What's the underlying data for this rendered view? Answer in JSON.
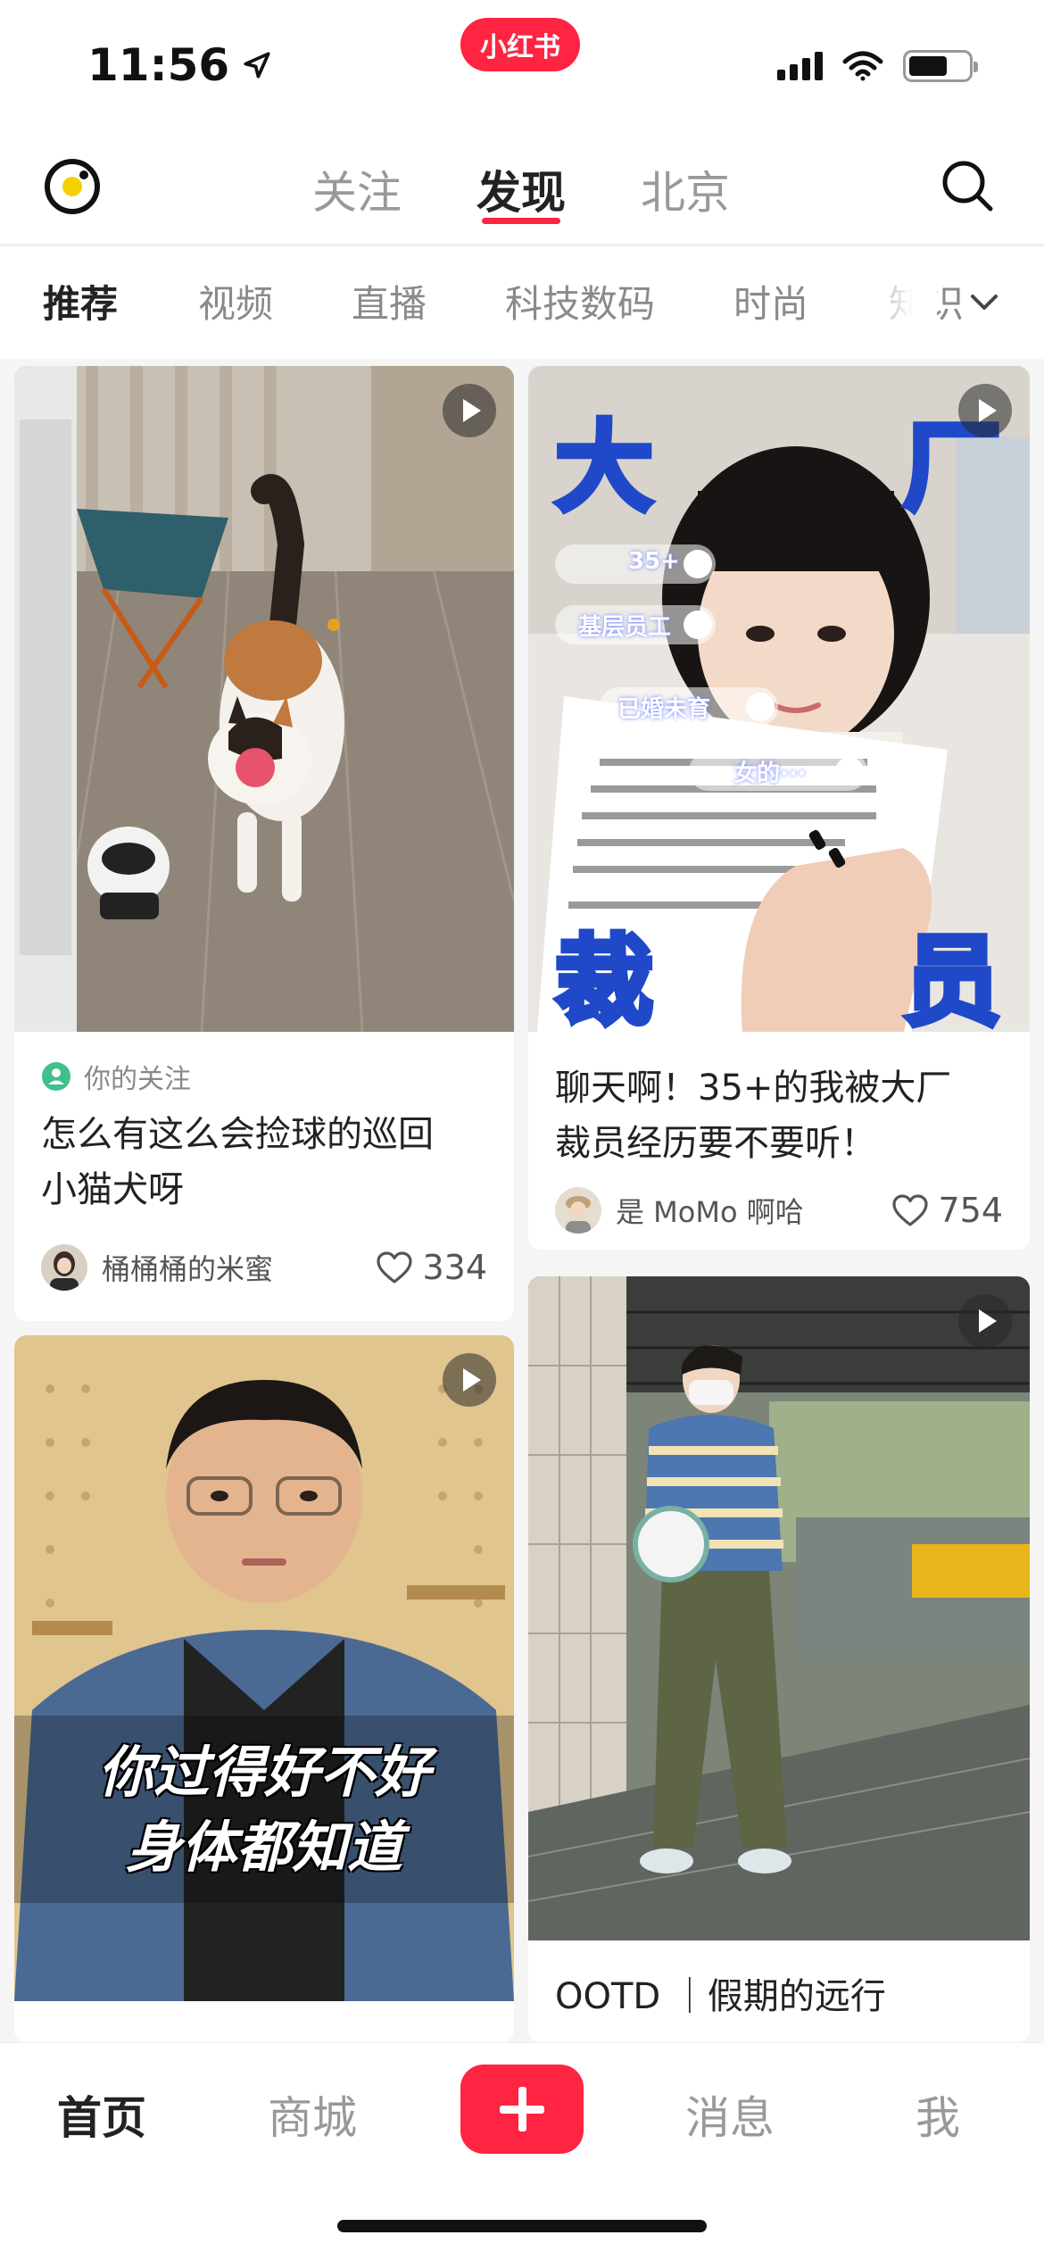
{
  "status_bar": {
    "time": "11:56",
    "app_logo": "小红书"
  },
  "top_nav": {
    "tabs": [
      {
        "label": "关注"
      },
      {
        "label": "发现",
        "active": true
      },
      {
        "label": "北京"
      }
    ],
    "accent": "#ff2442"
  },
  "categories": {
    "items": [
      "推荐",
      "视频",
      "直播",
      "科技数码",
      "时尚",
      "知识"
    ],
    "active": "推荐"
  },
  "feed": [
    {
      "tag": "你的关注",
      "title_line1": "怎么有这么会捡球的巡回",
      "title_line2": "小猫犬呀",
      "author": "桶桶桶的米蜜",
      "likes": "334",
      "is_video": true
    },
    {
      "overlay": {
        "tl": "大",
        "tr": "厂",
        "bl": "裁",
        "br": "员"
      },
      "toggles": [
        "35+",
        "基层员工",
        "已婚未育",
        "女的···"
      ],
      "title_line1": "聊天啊！35+的我被大厂",
      "title_line2": "裁员经历要不要听！",
      "author": "是 MoMo 啊哈",
      "likes": "754",
      "is_video": true
    },
    {
      "caption_line1": "你过得好不好",
      "caption_line2": "身体都知道",
      "is_video": true
    },
    {
      "title_line1": "OOTD ｜假期的远行",
      "is_video": true
    }
  ],
  "bottom_tabs": [
    {
      "label": "首页",
      "active": true
    },
    {
      "label": "商城"
    },
    {
      "label": "消息"
    },
    {
      "label": "我"
    }
  ]
}
